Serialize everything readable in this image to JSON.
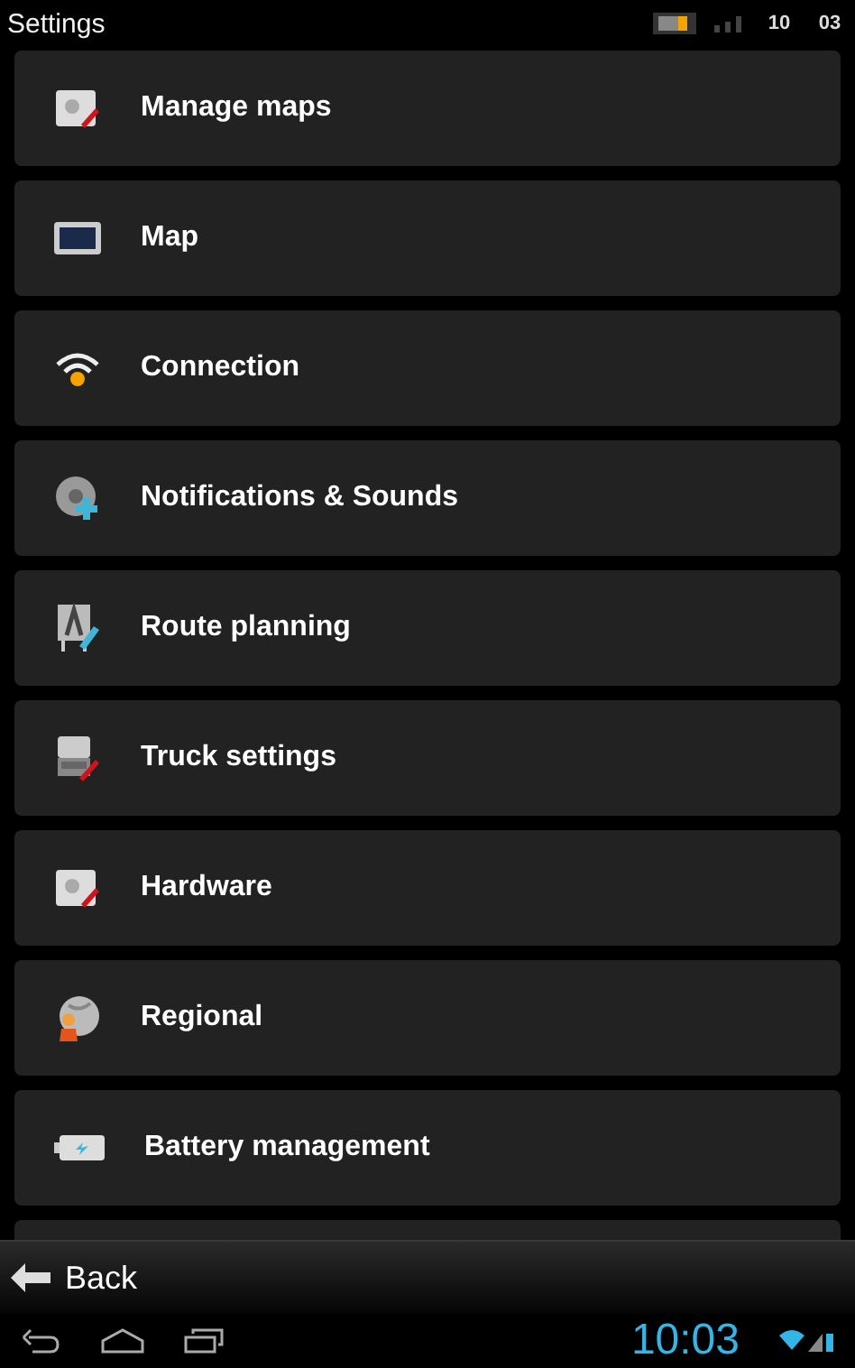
{
  "header": {
    "title": "Settings",
    "status_hours": "10",
    "status_minutes": "03"
  },
  "items": [
    {
      "label": "Manage maps",
      "kind": "tool"
    },
    {
      "label": "Map",
      "kind": "screen"
    },
    {
      "label": "Connection",
      "kind": "wifi"
    },
    {
      "label": "Notifications & Sounds",
      "kind": "sound"
    },
    {
      "label": "Route planning",
      "kind": "route"
    },
    {
      "label": "Truck settings",
      "kind": "truck"
    },
    {
      "label": "Hardware",
      "kind": "tool"
    },
    {
      "label": "Regional",
      "kind": "globe"
    },
    {
      "label": "Battery management",
      "kind": "battery"
    }
  ],
  "back_button": {
    "label": "Back"
  },
  "system_bar": {
    "time": "10:03"
  }
}
